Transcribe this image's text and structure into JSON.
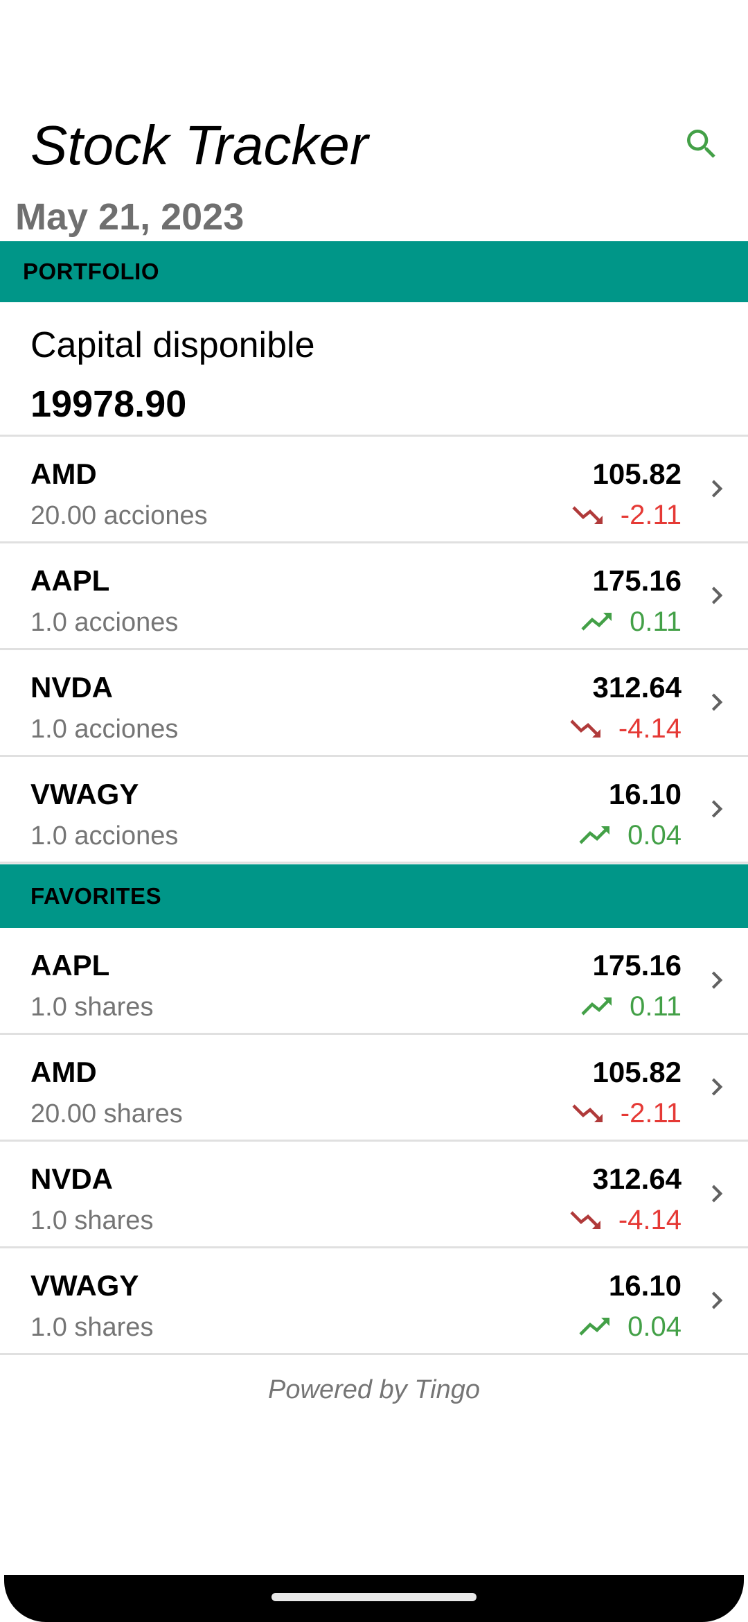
{
  "header": {
    "title": "Stock Tracker",
    "date": "May 21, 2023",
    "search_icon": "search-icon"
  },
  "portfolio": {
    "section_label": "PORTFOLIO",
    "capital_label": "Capital disponible",
    "capital_value": "19978.90",
    "items": [
      {
        "symbol": "AMD",
        "shares": "20.00 acciones",
        "price": "105.82",
        "change": "-2.11",
        "trend": "down"
      },
      {
        "symbol": "AAPL",
        "shares": "1.0 acciones",
        "price": "175.16",
        "change": "0.11",
        "trend": "up"
      },
      {
        "symbol": "NVDA",
        "shares": "1.0 acciones",
        "price": "312.64",
        "change": "-4.14",
        "trend": "down"
      },
      {
        "symbol": "VWAGY",
        "shares": "1.0 acciones",
        "price": "16.10",
        "change": "0.04",
        "trend": "up"
      }
    ]
  },
  "favorites": {
    "section_label": "FAVORITES",
    "items": [
      {
        "symbol": "AAPL",
        "shares": "1.0 shares",
        "price": "175.16",
        "change": "0.11",
        "trend": "up"
      },
      {
        "symbol": "AMD",
        "shares": "20.00 shares",
        "price": "105.82",
        "change": "-2.11",
        "trend": "down"
      },
      {
        "symbol": "NVDA",
        "shares": "1.0 shares",
        "price": "312.64",
        "change": "-4.14",
        "trend": "down"
      },
      {
        "symbol": "VWAGY",
        "shares": "1.0 shares",
        "price": "16.10",
        "change": "0.04",
        "trend": "up"
      }
    ]
  },
  "footer": {
    "text": "Powered by Tingo"
  },
  "colors": {
    "accent": "#009688",
    "up": "#43a047",
    "down": "#e53935",
    "down_icon": "#b03a3a",
    "search": "#43a047"
  },
  "icons": {
    "trend_up": "trending-up-icon",
    "trend_down": "trending-down-icon",
    "chevron": "chevron-right-icon"
  }
}
